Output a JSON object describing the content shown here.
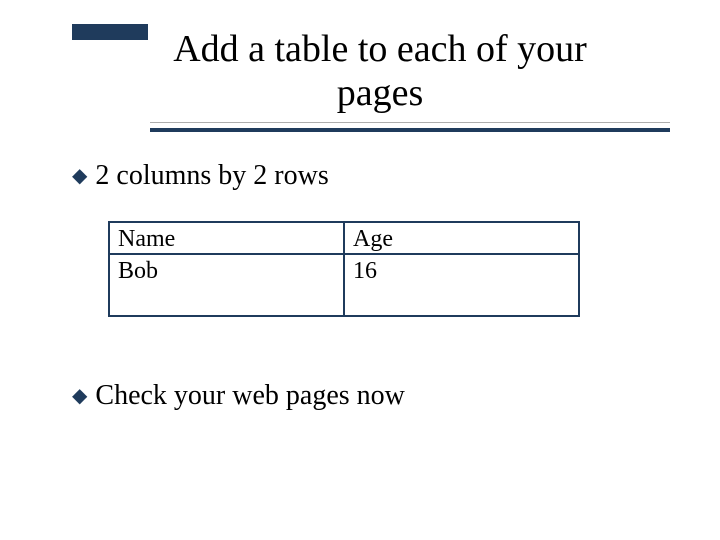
{
  "title": "Add a table to each of your pages",
  "bullets": [
    "2 columns by 2 rows",
    "Check your web pages now"
  ],
  "table": {
    "rows": [
      {
        "col1": "Name",
        "col2": "Age"
      },
      {
        "col1": "Bob",
        "col2": "16"
      }
    ]
  },
  "colors": {
    "accent": "#1f3b5c"
  }
}
